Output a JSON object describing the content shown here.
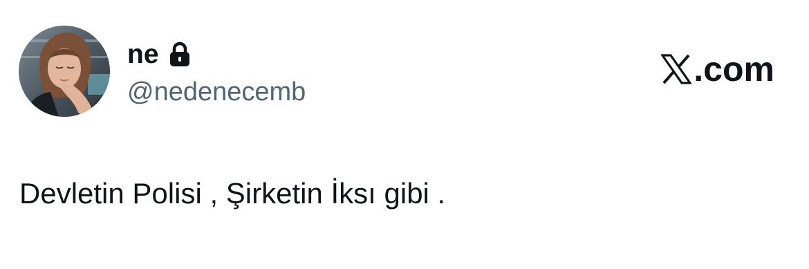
{
  "author": {
    "display_name": "ne",
    "handle": "@nedenecemb",
    "protected": true,
    "avatar_icon": "profile-photo"
  },
  "brand": {
    "logo_icon": "x-logo-icon",
    "suffix": ".com"
  },
  "tweet": {
    "text": "Devletin Polisi , Şirketin İksı gibi ."
  },
  "colors": {
    "text_primary": "#0f1419",
    "text_secondary": "#536471",
    "background": "#ffffff"
  }
}
